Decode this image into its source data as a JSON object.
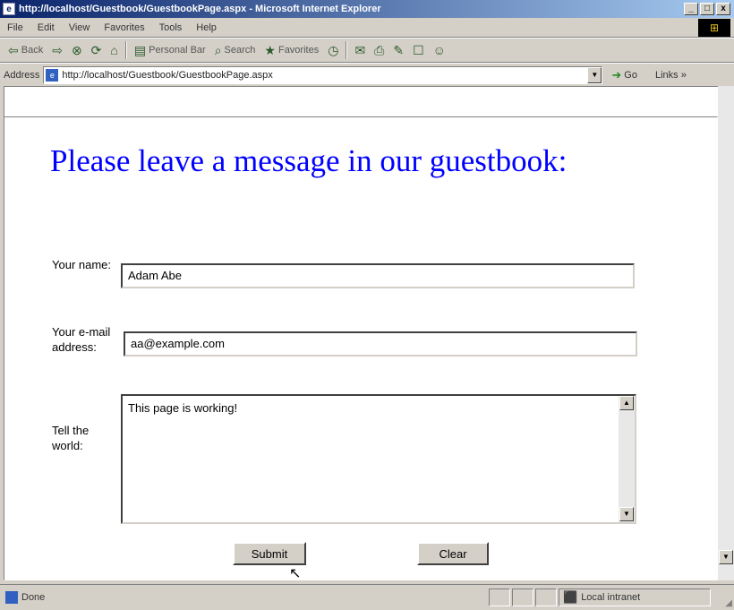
{
  "window": {
    "title": "http://localhost/Guestbook/GuestbookPage.aspx - Microsoft Internet Explorer",
    "buttons": [
      "_",
      "□",
      "x"
    ]
  },
  "menu": [
    "File",
    "Edit",
    "View",
    "Favorites",
    "Tools",
    "Help"
  ],
  "toolbar": {
    "back": "Back",
    "personal_bar": "Personal Bar",
    "search": "Search",
    "favorites": "Favorites"
  },
  "address": {
    "label": "Address",
    "url": "http://localhost/Guestbook/GuestbookPage.aspx",
    "go": "Go",
    "links": "Links »"
  },
  "page": {
    "heading": "Please leave a message in our guestbook:",
    "name_label": "Your name:",
    "name_value": "Adam Abe",
    "email_label": "Your e-mail address:",
    "email_value": "aa@example.com",
    "message_label": "Tell the world:",
    "message_value": "This page is working!",
    "submit": "Submit",
    "clear": "Clear"
  },
  "status": {
    "text": "Done",
    "zone": "Local intranet"
  }
}
